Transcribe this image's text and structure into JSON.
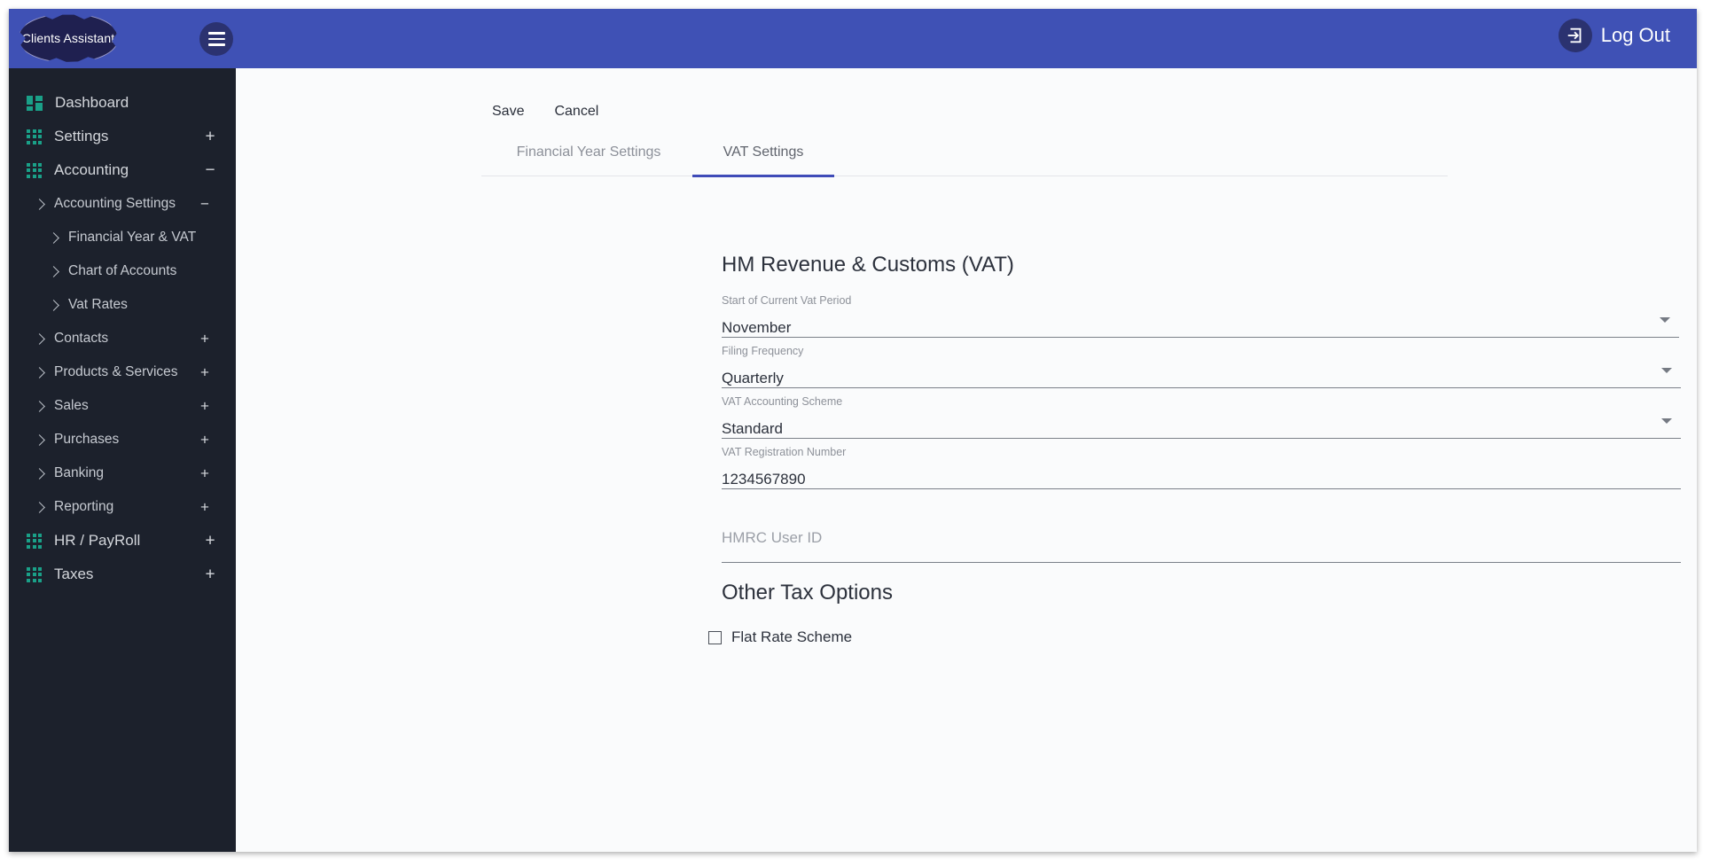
{
  "header": {
    "logo_text": "Clients Assistant",
    "menu_icon": "hamburger-menu-icon",
    "logout_label": "Log Out",
    "logout_icon": "logout-exit-icon",
    "background_color": "#3f51b5"
  },
  "sidebar": {
    "background_color": "#1c212c",
    "accent_icon_color": "#1aa088",
    "items": [
      {
        "label": "Dashboard",
        "level": 0,
        "icon": "dashboard-grid-icon",
        "toggle": ""
      },
      {
        "label": "Settings",
        "level": 0,
        "icon": "apps-grid-icon",
        "toggle": "+"
      },
      {
        "label": "Accounting",
        "level": 0,
        "icon": "apps-grid-icon",
        "toggle": "−"
      },
      {
        "label": "Accounting Settings",
        "level": 1,
        "icon": "chevron-right-icon",
        "toggle": "−"
      },
      {
        "label": "Financial Year & VAT",
        "level": 2,
        "icon": "chevron-right-icon",
        "toggle": ""
      },
      {
        "label": "Chart of Accounts",
        "level": 2,
        "icon": "chevron-right-icon",
        "toggle": ""
      },
      {
        "label": "Vat Rates",
        "level": 2,
        "icon": "chevron-right-icon",
        "toggle": ""
      },
      {
        "label": "Contacts",
        "level": 1,
        "icon": "chevron-right-icon",
        "toggle": "+"
      },
      {
        "label": "Products & Services",
        "level": 1,
        "icon": "chevron-right-icon",
        "toggle": "+"
      },
      {
        "label": "Sales",
        "level": 1,
        "icon": "chevron-right-icon",
        "toggle": "+"
      },
      {
        "label": "Purchases",
        "level": 1,
        "icon": "chevron-right-icon",
        "toggle": "+"
      },
      {
        "label": "Banking",
        "level": 1,
        "icon": "chevron-right-icon",
        "toggle": "+"
      },
      {
        "label": "Reporting",
        "level": 1,
        "icon": "chevron-right-icon",
        "toggle": "+"
      },
      {
        "label": "HR / PayRoll",
        "level": 0,
        "icon": "apps-grid-icon",
        "toggle": "+"
      },
      {
        "label": "Taxes",
        "level": 0,
        "icon": "apps-grid-icon",
        "toggle": "+"
      }
    ]
  },
  "main": {
    "save_label": "Save",
    "cancel_label": "Cancel",
    "tabs": [
      {
        "label": "Financial Year Settings",
        "active": false
      },
      {
        "label": "VAT Settings",
        "active": true
      }
    ],
    "active_tab_color": "#3f4bb8",
    "vat_section": {
      "title": "HM Revenue & Customs (VAT)",
      "fields": [
        {
          "label": "Start of Current Vat Period",
          "value": "November",
          "placeholder": "",
          "type": "select",
          "name": "start-of-current-vat-period"
        },
        {
          "label": "Filing Frequency",
          "value": "Quarterly",
          "placeholder": "",
          "type": "select",
          "name": "filing-frequency"
        },
        {
          "label": "VAT Accounting Scheme",
          "value": "Standard",
          "placeholder": "",
          "type": "select",
          "name": "vat-accounting-scheme"
        },
        {
          "label": "VAT Registration Number",
          "value": "1234567890",
          "placeholder": "",
          "type": "text",
          "name": "vat-registration-number"
        },
        {
          "label": "",
          "value": "",
          "placeholder": "HMRC User ID",
          "type": "text",
          "name": "hmrc-user-id"
        }
      ]
    },
    "other_section": {
      "title": "Other Tax Options",
      "checkbox_label": "Flat Rate Scheme",
      "checkbox_checked": false
    }
  }
}
